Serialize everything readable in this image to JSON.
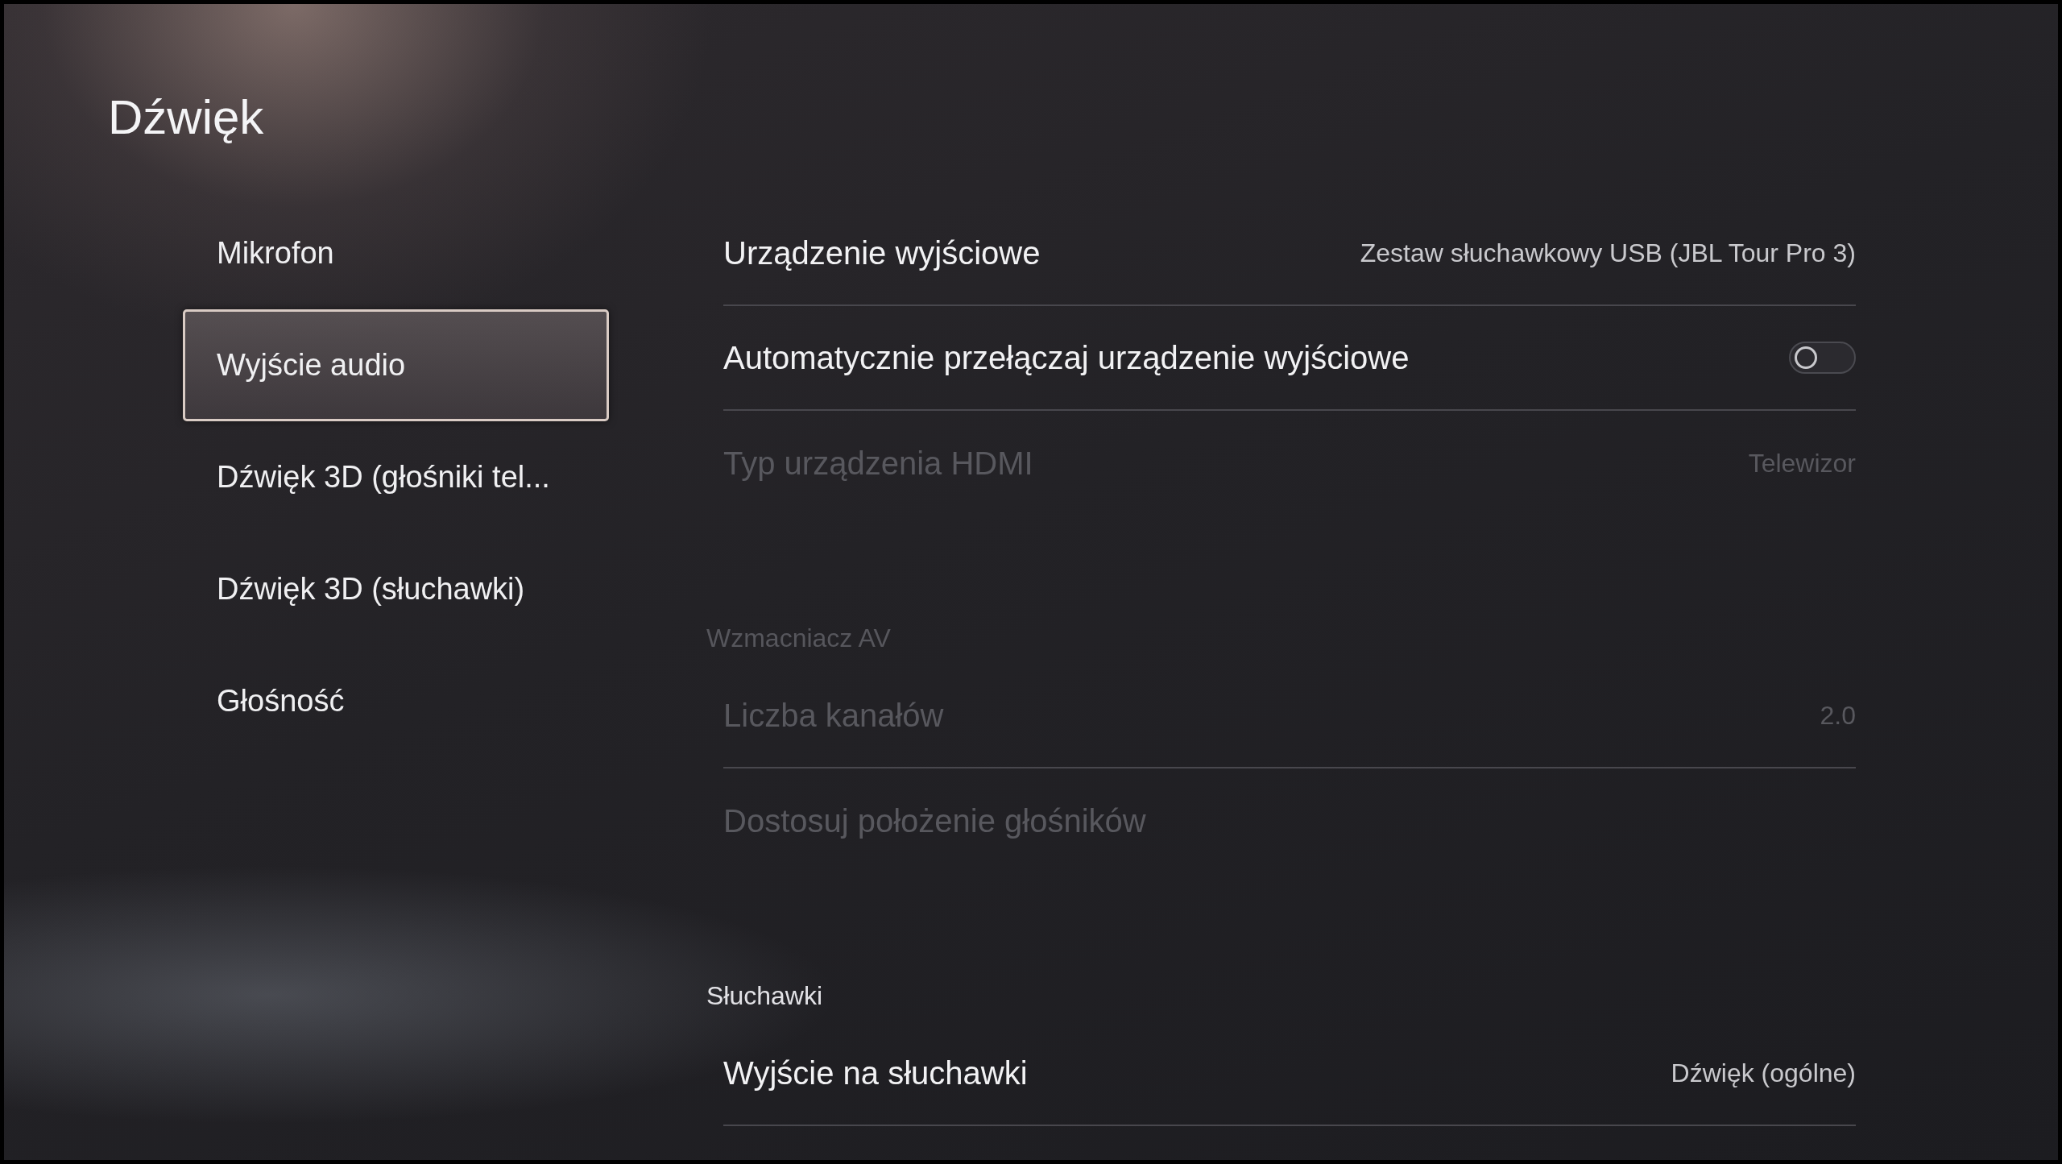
{
  "title": "Dźwięk",
  "sidebar": {
    "items": [
      {
        "label": "Mikrofon",
        "selected": false
      },
      {
        "label": "Wyjście audio",
        "selected": true
      },
      {
        "label": "Dźwięk 3D (głośniki tel...",
        "selected": false
      },
      {
        "label": "Dźwięk 3D (słuchawki)",
        "selected": false
      },
      {
        "label": "Głośność",
        "selected": false
      }
    ]
  },
  "sections": [
    {
      "rows": [
        {
          "kind": "value",
          "label": "Urządzenie wyjściowe",
          "value": "Zestaw słuchawkowy USB (JBL Tour Pro 3)",
          "disabled": false
        },
        {
          "kind": "toggle",
          "label": "Automatycznie przełączaj urządzenie wyjściowe",
          "on": false,
          "disabled": false
        },
        {
          "kind": "value",
          "label": "Typ urządzenia HDMI",
          "value": "Telewizor",
          "disabled": true
        }
      ]
    },
    {
      "header": "Wzmacniacz AV",
      "disabled": true,
      "rows": [
        {
          "kind": "value",
          "label": "Liczba kanałów",
          "value": "2.0",
          "disabled": true
        },
        {
          "kind": "value",
          "label": "Dostosuj położenie głośników",
          "disabled": true
        }
      ]
    },
    {
      "header": "Słuchawki",
      "disabled": false,
      "rows": [
        {
          "kind": "value",
          "label": "Wyjście na słuchawki",
          "value": "Dźwięk (ogólne)",
          "disabled": false
        }
      ]
    }
  ]
}
